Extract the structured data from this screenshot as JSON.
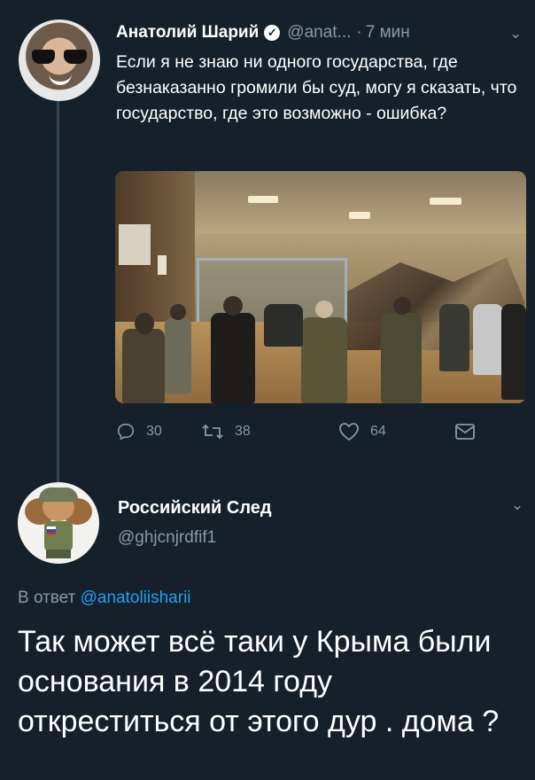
{
  "tweet1": {
    "author_name": "Анатолий Шарий",
    "verified_mark": "✓",
    "handle": "@anat...",
    "separator": "·",
    "time": "7 мин",
    "text": "Если я не знаю ни одного государства, где безнаказанно громили бы суд, могу я сказать, что государство, где это возможно - ошибка?",
    "stats": {
      "replies": "30",
      "retweets": "38",
      "likes": "64"
    }
  },
  "tweet2": {
    "author_name": "Российский След",
    "handle": "@ghjcnjrdfif1",
    "reply_prefix": "В ответ",
    "reply_to": "@anatoliisharii",
    "text": "Так может всё таки у Крыма были основания в 2014 году откреститься от этого дур . дома ?"
  },
  "icons": {
    "menu": "chevron-down-icon",
    "reply": "reply-icon",
    "retweet": "retweet-icon",
    "like": "heart-icon",
    "message": "envelope-icon"
  },
  "colors": {
    "background": "#15202b",
    "secondary_text": "#8899a6",
    "link": "#1da1f2",
    "thread_line": "#38444d"
  }
}
